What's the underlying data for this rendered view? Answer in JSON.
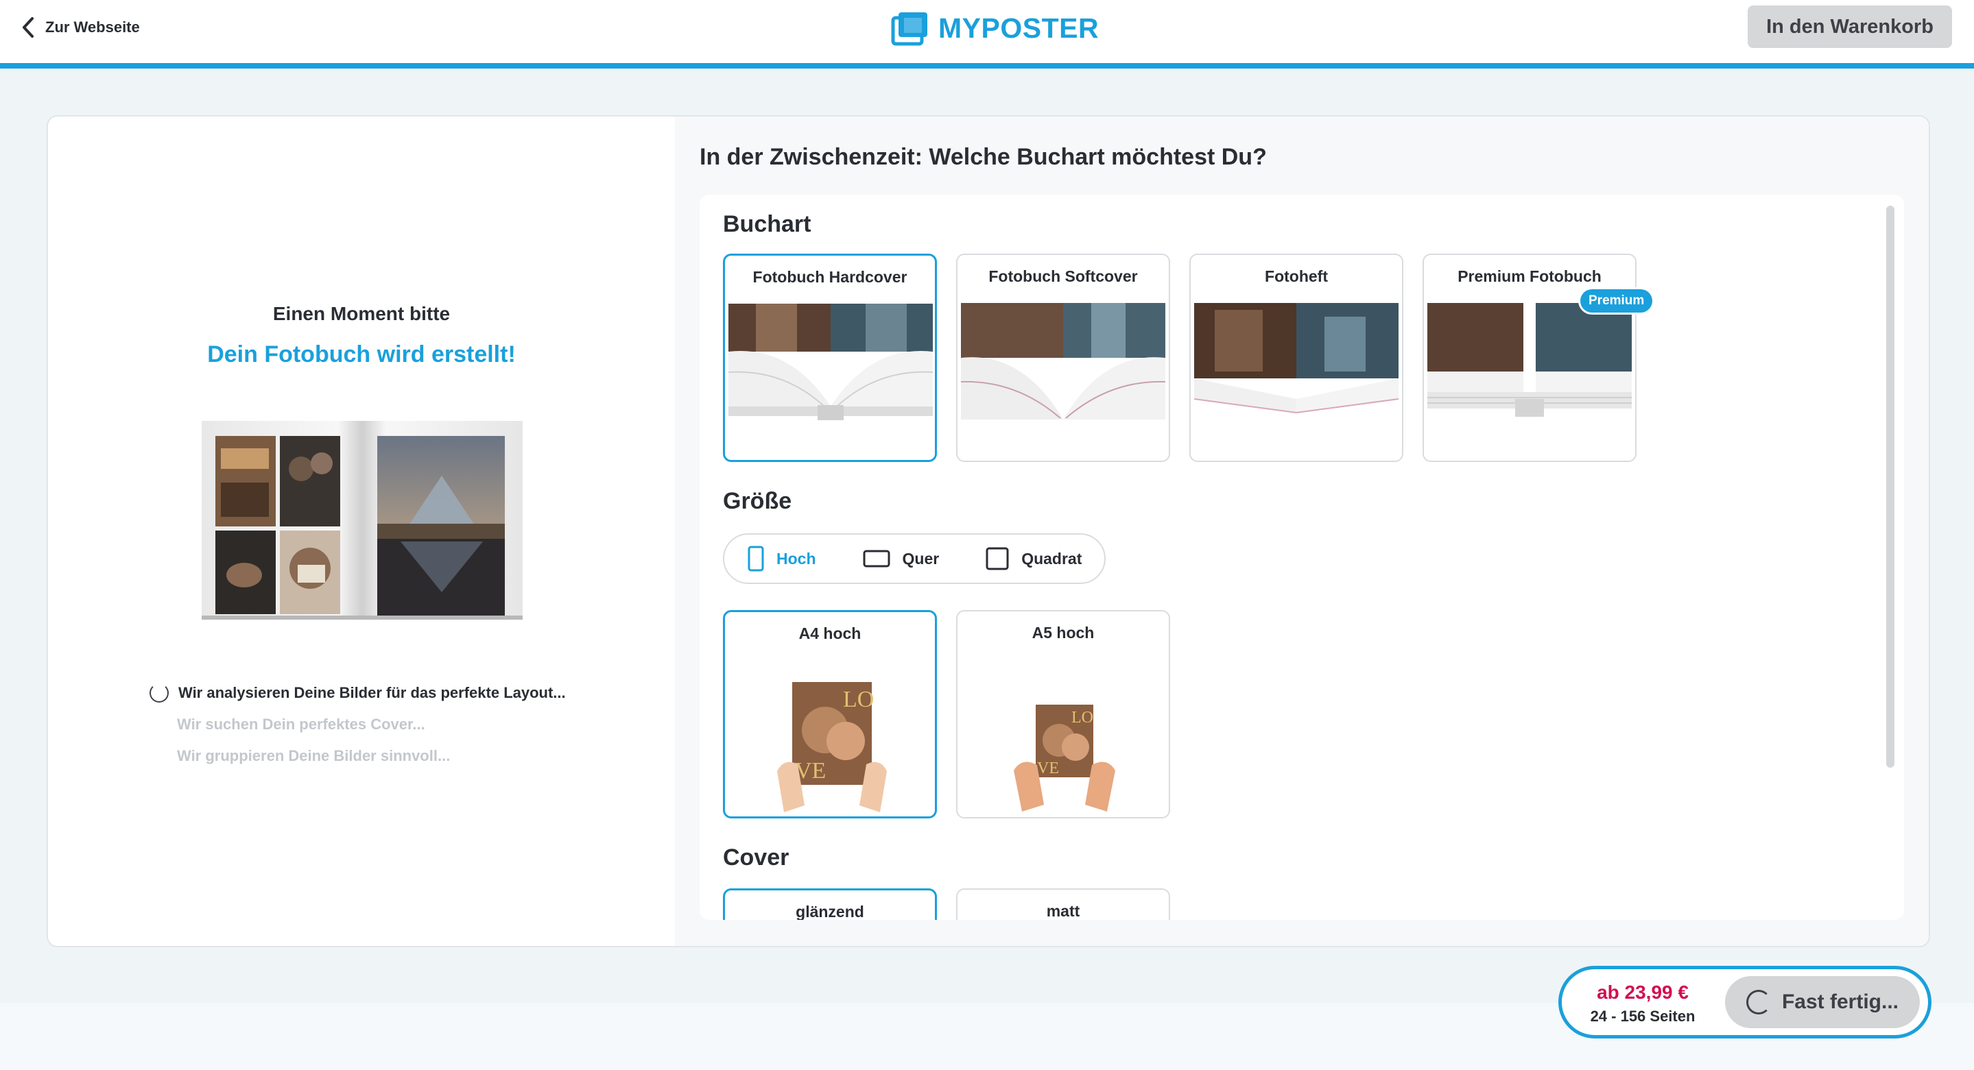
{
  "header": {
    "back_label": "Zur Webseite",
    "logo_text": "MYPOSTER",
    "cart_button": "In den Warenkorb"
  },
  "loading": {
    "title": "Einen Moment bitte",
    "subtitle": "Dein Fotobuch wird erstellt!",
    "steps": [
      "Wir analysieren Deine Bilder für das perfekte Layout...",
      "Wir suchen Dein perfektes Cover...",
      "Wir gruppieren Deine Bilder sinnvoll..."
    ]
  },
  "config": {
    "question": "In der Zwischenzeit: Welche Buchart möchtest Du?",
    "buchart": {
      "title": "Buchart",
      "options": [
        {
          "label": "Fotobuch Hardcover",
          "selected": true
        },
        {
          "label": "Fotobuch Softcover",
          "selected": false
        },
        {
          "label": "Fotoheft",
          "selected": false
        },
        {
          "label": "Premium Fotobuch",
          "selected": false,
          "badge": "Premium"
        }
      ]
    },
    "groesse": {
      "title": "Größe",
      "orientations": [
        {
          "label": "Hoch",
          "active": true
        },
        {
          "label": "Quer",
          "active": false
        },
        {
          "label": "Quadrat",
          "active": false
        }
      ],
      "sizes": [
        {
          "label": "A4 hoch",
          "selected": true
        },
        {
          "label": "A5 hoch",
          "selected": false
        }
      ]
    },
    "cover": {
      "title": "Cover",
      "options": [
        {
          "label": "glänzend",
          "selected": true
        },
        {
          "label": "matt",
          "selected": false
        }
      ]
    }
  },
  "footer": {
    "price": "ab 23,99 €",
    "pages": "24 - 156 Seiten",
    "button": "Fast fertig..."
  },
  "colors": {
    "accent": "#1aa0dc",
    "price": "#d1104f"
  }
}
